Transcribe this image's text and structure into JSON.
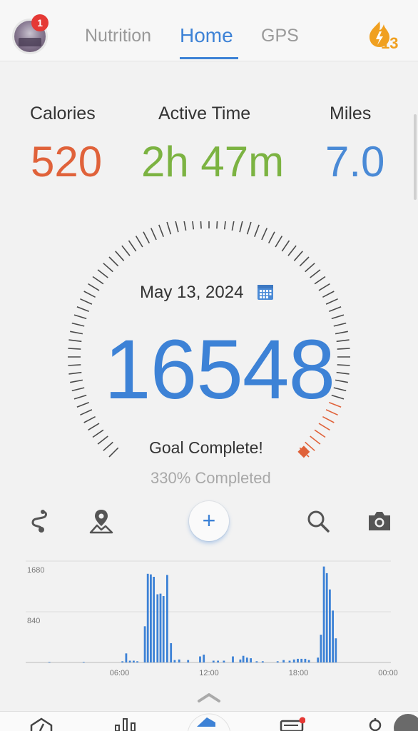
{
  "header": {
    "notification_count": "1",
    "tabs": [
      "Nutrition",
      "Home",
      "GPS"
    ],
    "active_tab": "Home",
    "streak_count": "13"
  },
  "stats": {
    "calories": {
      "label": "Calories",
      "value": "520",
      "color": "#e0623a"
    },
    "active_time": {
      "label": "Active Time",
      "value": "2h 47m",
      "color": "#7cb342"
    },
    "miles": {
      "label": "Miles",
      "value": "7.0",
      "color": "#4a8ad6"
    }
  },
  "gauge": {
    "date": "May 13, 2024",
    "steps": "16548",
    "status": "Goal Complete!",
    "percent_text": "330% Completed"
  },
  "actions": {
    "icons": [
      "route-icon",
      "map-pin-icon",
      "add-icon",
      "search-icon",
      "camera-icon"
    ],
    "add_label": "+"
  },
  "chart_data": {
    "type": "bar",
    "y_ticks": [
      "1680",
      "840"
    ],
    "x_ticks": [
      "06:00",
      "12:00",
      "18:00",
      "00:00"
    ],
    "ylim": [
      0,
      1680
    ],
    "x_range_hours": [
      0,
      24
    ],
    "color": "#3d82d6",
    "bars": [
      {
        "t": 1.3,
        "v": 10
      },
      {
        "t": 3.6,
        "v": 10
      },
      {
        "t": 6.2,
        "v": 20
      },
      {
        "t": 6.45,
        "v": 150
      },
      {
        "t": 6.7,
        "v": 30
      },
      {
        "t": 6.95,
        "v": 30
      },
      {
        "t": 7.2,
        "v": 20
      },
      {
        "t": 7.7,
        "v": 600
      },
      {
        "t": 7.9,
        "v": 1470
      },
      {
        "t": 8.1,
        "v": 1460
      },
      {
        "t": 8.3,
        "v": 1420
      },
      {
        "t": 8.55,
        "v": 1130
      },
      {
        "t": 8.75,
        "v": 1140
      },
      {
        "t": 8.95,
        "v": 1100
      },
      {
        "t": 9.2,
        "v": 1450
      },
      {
        "t": 9.45,
        "v": 320
      },
      {
        "t": 9.7,
        "v": 40
      },
      {
        "t": 10.0,
        "v": 50
      },
      {
        "t": 10.6,
        "v": 40
      },
      {
        "t": 11.4,
        "v": 100
      },
      {
        "t": 11.65,
        "v": 130
      },
      {
        "t": 12.3,
        "v": 30
      },
      {
        "t": 12.6,
        "v": 30
      },
      {
        "t": 13.0,
        "v": 30
      },
      {
        "t": 13.6,
        "v": 100
      },
      {
        "t": 14.1,
        "v": 50
      },
      {
        "t": 14.3,
        "v": 110
      },
      {
        "t": 14.55,
        "v": 80
      },
      {
        "t": 14.8,
        "v": 70
      },
      {
        "t": 15.2,
        "v": 20
      },
      {
        "t": 15.6,
        "v": 20
      },
      {
        "t": 16.6,
        "v": 20
      },
      {
        "t": 17.0,
        "v": 40
      },
      {
        "t": 17.4,
        "v": 30
      },
      {
        "t": 17.7,
        "v": 50
      },
      {
        "t": 17.95,
        "v": 60
      },
      {
        "t": 18.2,
        "v": 60
      },
      {
        "t": 18.45,
        "v": 60
      },
      {
        "t": 18.7,
        "v": 40
      },
      {
        "t": 19.3,
        "v": 80
      },
      {
        "t": 19.5,
        "v": 460
      },
      {
        "t": 19.7,
        "v": 1590
      },
      {
        "t": 19.9,
        "v": 1480
      },
      {
        "t": 20.1,
        "v": 1210
      },
      {
        "t": 20.3,
        "v": 860
      },
      {
        "t": 20.5,
        "v": 400
      }
    ]
  },
  "bottom_nav": {
    "icons": [
      "dashboard-icon",
      "stats-icon",
      "home-icon",
      "messages-icon",
      "profile-icon"
    ]
  }
}
